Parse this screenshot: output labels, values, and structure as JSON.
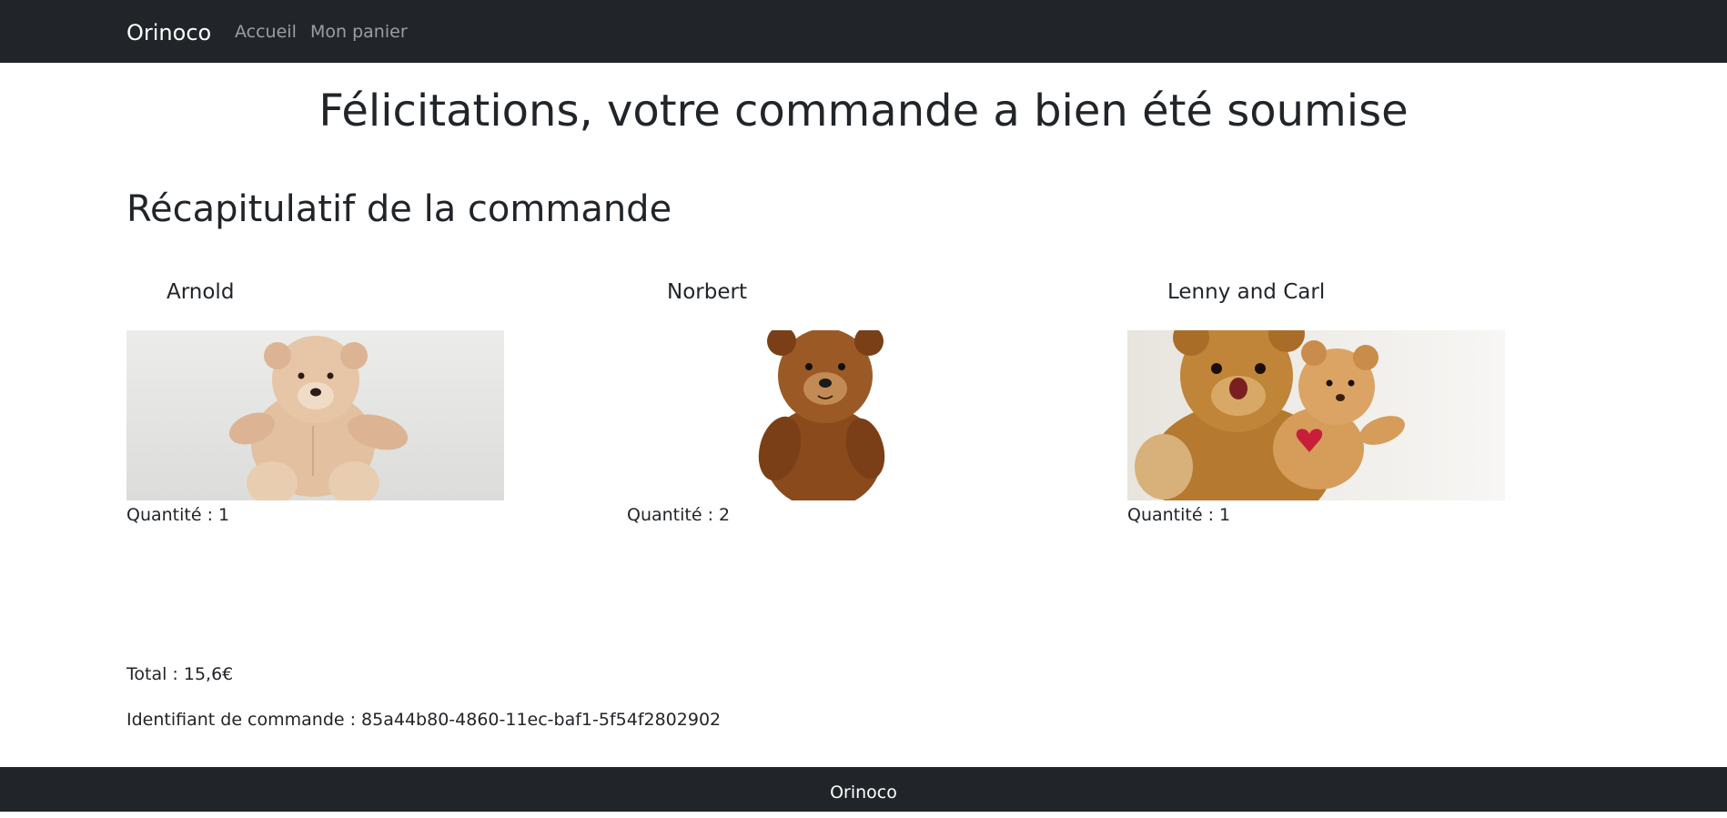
{
  "navbar": {
    "brand": "Orinoco",
    "links": [
      "Accueil",
      "Mon panier"
    ]
  },
  "page_title": "Félicitations, votre commande a bien été soumise",
  "summary_title": "Récapitulatif de la commande",
  "products": [
    {
      "name": "Arnold",
      "quantity_label": "Quantité : 1",
      "image_icon": "beige-teddy-bear-photo"
    },
    {
      "name": "Norbert",
      "quantity_label": "Quantité : 2",
      "image_icon": "brown-teddy-bear-photo"
    },
    {
      "name": "Lenny and Carl",
      "quantity_label": "Quantité : 1",
      "image_icon": "two-teddy-bears-photo"
    }
  ],
  "total_label": "Total : 15,6€",
  "order_id_label": "Identifiant de commande : 85a44b80-4860-11ec-baf1-5f54f2802902",
  "footer": {
    "text": "Orinoco"
  },
  "colors": {
    "navbar_bg": "#212529",
    "text": "#212529",
    "nav_link": "#8c8f92"
  }
}
